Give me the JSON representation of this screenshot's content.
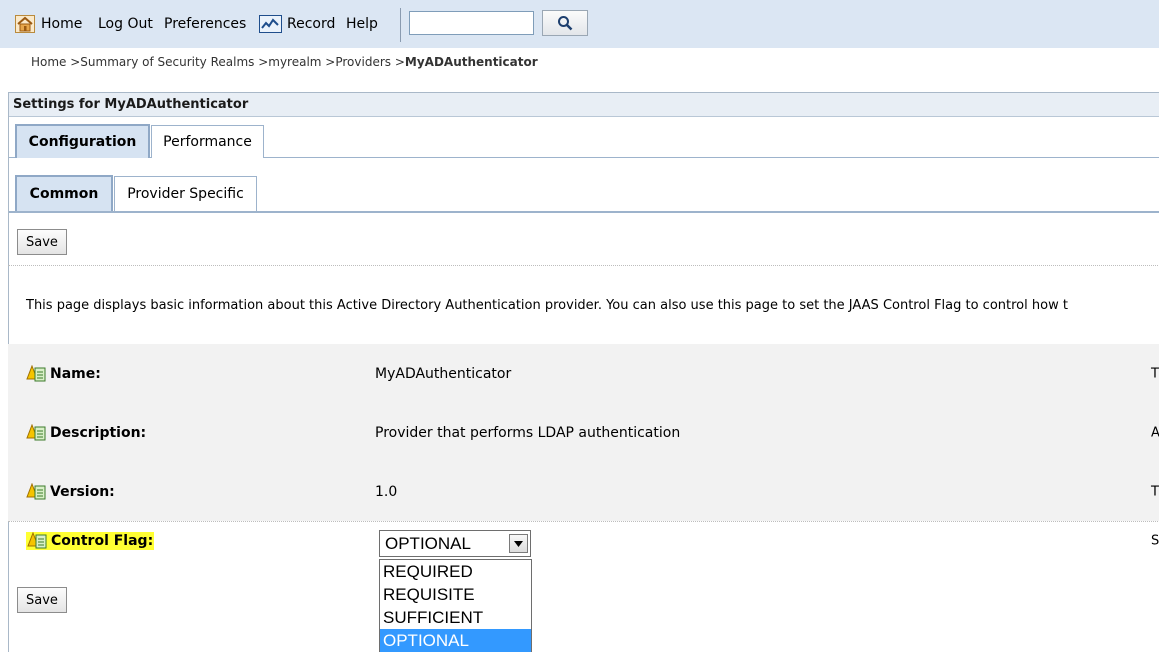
{
  "toolbar": {
    "home": "Home",
    "logout": "Log Out",
    "preferences": "Preferences",
    "record": "Record",
    "help": "Help",
    "search_value": ""
  },
  "breadcrumb": {
    "path": "Home >Summary of Security Realms >myrealm >Providers >",
    "current": "MyADAuthenticator"
  },
  "settings_title": "Settings for MyADAuthenticator",
  "tabs": [
    {
      "label": "Configuration",
      "active": true
    },
    {
      "label": "Performance",
      "active": false
    }
  ],
  "subtabs": [
    {
      "label": "Common",
      "active": true
    },
    {
      "label": "Provider Specific",
      "active": false
    }
  ],
  "save_label": "Save",
  "description": "This page displays basic information about this Active Directory Authentication provider. You can also use this page to set the JAAS Control Flag to control how t",
  "fields": [
    {
      "label": "Name:",
      "value": "MyADAuthenticator",
      "right": "T"
    },
    {
      "label": "Description:",
      "value": "Provider that performs LDAP authentication",
      "right": "A"
    },
    {
      "label": "Version:",
      "value": "1.0",
      "right": "T"
    }
  ],
  "control_flag": {
    "label": "Control Flag:",
    "selected": "OPTIONAL",
    "right": "S",
    "options": [
      "REQUIRED",
      "REQUISITE",
      "SUFFICIENT",
      "OPTIONAL"
    ]
  },
  "colors": {
    "toolbar_bg": "#dbe6f3",
    "highlight": "#ffff33",
    "selected_option": "#3399ff"
  }
}
